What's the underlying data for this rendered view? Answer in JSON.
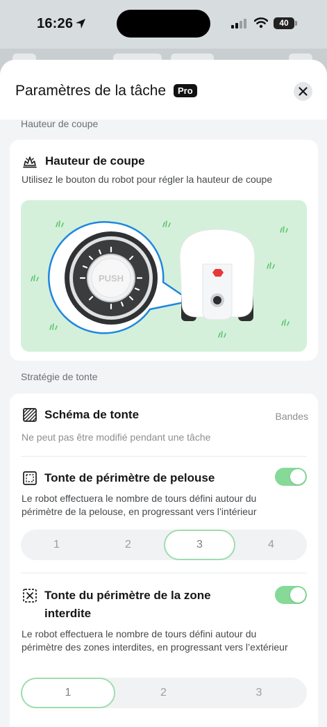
{
  "status": {
    "time": "16:26",
    "battery": "40"
  },
  "sheet": {
    "title": "Paramètres de la tâche",
    "badge": "Pro"
  },
  "cutting": {
    "section_label": "Hauteur de coupe",
    "title": "Hauteur de coupe",
    "description": "Utilisez le bouton du robot pour régler la hauteur de coupe",
    "knob_label": "PUSH"
  },
  "strategy": {
    "section_label": "Stratégie de tonte",
    "pattern": {
      "title": "Schéma de tonte",
      "value": "Bandes",
      "note": "Ne peut pas être modifié pendant une tâche"
    },
    "lawn_perimeter": {
      "title": "Tonte de périmètre de pelouse",
      "enabled": true,
      "description": "Le robot effectuera le nombre de tours défini autour du périmètre de la pelouse, en progressant vers l’intérieur",
      "options": [
        "1",
        "2",
        "3",
        "4"
      ],
      "selected": "3"
    },
    "nogo_perimeter": {
      "title_line1": "Tonte du périmètre de la zone",
      "title_line2": "interdite",
      "enabled": true,
      "description": "Le robot effectuera le nombre de tours défini autour du périmètre des zones interdites, en progressant vers l’extérieur",
      "options": [
        "1",
        "2",
        "3"
      ],
      "selected": "1"
    }
  },
  "colors": {
    "accent_green": "#86d997",
    "illustration_bg": "#d4f0da",
    "ring_blue": "#1f86e0",
    "robot_red": "#e8383a"
  }
}
